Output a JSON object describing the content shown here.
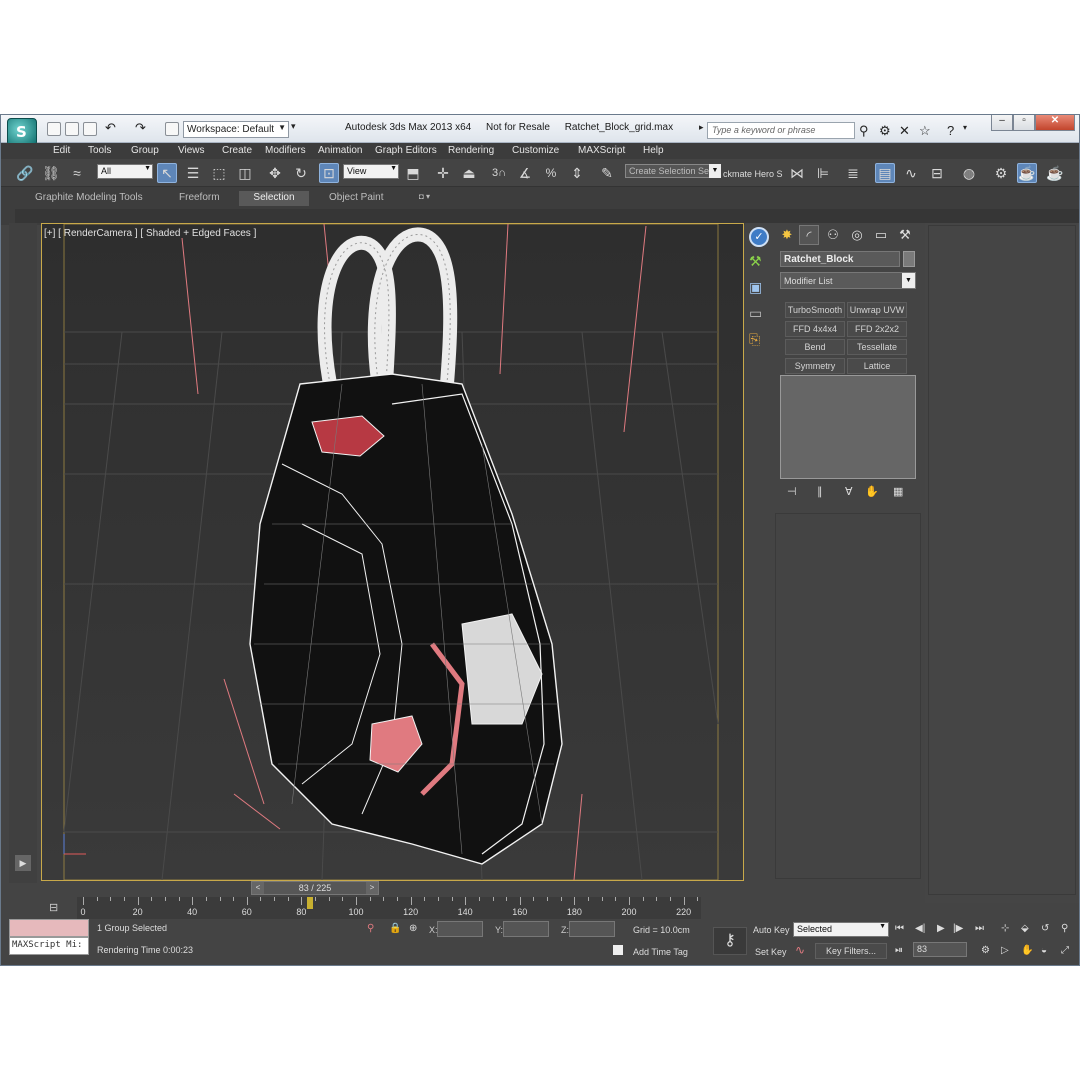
{
  "titlebar": {
    "workspace": "Workspace: Default",
    "app_title": "Autodesk 3ds Max  2013 x64",
    "license": "Not for Resale",
    "file_name": "Ratchet_Block_grid.max",
    "search_placeholder": "Type a keyword or phrase"
  },
  "menu": [
    "Edit",
    "Tools",
    "Group",
    "Views",
    "Create",
    "Modifiers",
    "Animation",
    "Graph Editors",
    "Rendering",
    "Customize",
    "MAXScript",
    "Help"
  ],
  "toolbar": {
    "filter_value": "All",
    "coord_system": "View",
    "snap_label": "3",
    "selection_set_placeholder": "Create Selection Se",
    "hero_label": "ckmate Hero S"
  },
  "ribbon": {
    "tabs": [
      "Graphite Modeling Tools",
      "Freeform",
      "Selection",
      "Object Paint"
    ],
    "active_tab": "Selection"
  },
  "viewport": {
    "label": "[+] [ RenderCamera ] [ Shaded + Edged Faces ]"
  },
  "command_panel": {
    "object_name": "Ratchet_Block",
    "modifier_list": "Modifier List",
    "modifier_buttons": [
      "TurboSmooth",
      "Unwrap UVW",
      "FFD 4x4x4",
      "FFD 2x2x2",
      "Bend",
      "Tessellate",
      "Symmetry",
      "Lattice"
    ]
  },
  "timeline": {
    "slider_text": "83 / 225",
    "current_frame": 83,
    "total_frames": 225,
    "ticks": [
      "0",
      "20",
      "40",
      "60",
      "80",
      "100",
      "120",
      "140",
      "160",
      "180",
      "200",
      "220"
    ]
  },
  "status": {
    "maxscript_label": "MAXScript Mi:",
    "selection_text": "1 Group Selected",
    "render_time": "Rendering Time  0:00:23",
    "x_label": "X:",
    "y_label": "Y:",
    "z_label": "Z:",
    "grid": "Grid = 10.0cm",
    "add_time_tag": "Add Time Tag",
    "auto_key": "Auto Key",
    "set_key": "Set Key",
    "key_mode": "Selected",
    "key_filters": "Key Filters...",
    "frame_value": "83"
  },
  "colors": {
    "active_blue": "#5e86b8",
    "viewport_border": "#c8a94a",
    "selection_red": "#e07a80"
  }
}
